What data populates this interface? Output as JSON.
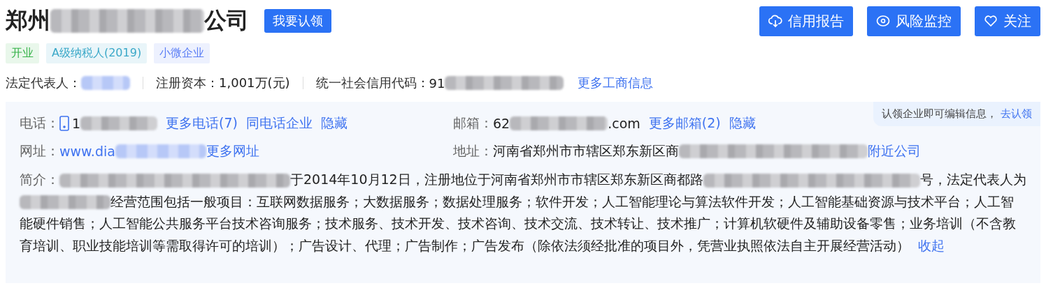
{
  "company": {
    "name_parts": [
      {
        "kind": "text",
        "text": "郑州"
      },
      {
        "kind": "blur"
      },
      {
        "kind": "text",
        "text": "公司"
      }
    ],
    "claim_button": "我要认领"
  },
  "actions": [
    {
      "kind": "report",
      "label": "信用报告"
    },
    {
      "kind": "monitor",
      "label": "风险监控"
    },
    {
      "kind": "follow",
      "label": "关注"
    }
  ],
  "tags": [
    {
      "label": "开业",
      "color": "#37b34a"
    },
    {
      "label": "A级纳税人(2019)",
      "color": "#3aa8c8"
    },
    {
      "label": "小微企业",
      "color": "#5b7ef5"
    }
  ],
  "basic": {
    "legal_rep_label": "法定代表人：",
    "capital_label": "注册资本：",
    "capital_value": "1,001万(元)",
    "credit_code_label": "统一社会信用代码：",
    "credit_code_value": "91",
    "more_link": "更多工商信息"
  },
  "contact": {
    "phone_label": "电话：",
    "phone_value": "1",
    "phone_links": [
      "更多电话(7)",
      "同电话企业",
      "隐藏"
    ],
    "email_label": "邮箱：",
    "email_value_start": "62",
    "email_value_end": ".com",
    "email_links": [
      "更多邮箱(2)",
      "隐藏"
    ],
    "website_label": "网址：",
    "website_value": "www.dia",
    "website_more": "更多网址",
    "address_label": "地址：",
    "address_value": "河南省郑州市市辖区郑东新区商",
    "address_link": "附近公司",
    "claim_hint": "认领企业即可编辑信息，",
    "claim_link": "去认领"
  },
  "intro": {
    "label": "简介：",
    "parts": [
      {
        "kind": "blur"
      },
      {
        "kind": "text",
        "text": "于2014年10月12日，注册地位于河南省郑州市市辖区郑东新区商都路"
      },
      {
        "kind": "blur"
      },
      {
        "kind": "text",
        "text": "号，法定代表人为"
      },
      {
        "kind": "blur"
      },
      {
        "kind": "text",
        "text": "经营范围包括一般项目：互联网数据服务；大数据服务；数据处理服务；软件开发；人工智能理论与算法软件开发；人工智能基础资源与技术平台；人工智能硬件销售；人工智能公共服务平台技术咨询服务；技术服务、技术开发、技术咨询、技术交流、技术转让、技术推广；计算机软硬件及辅助设备零售；业务培训（不含教育培训、职业技能培训等需取得许可的培训）；广告设计、代理；广告制作；广告发布（除依法须经批准的项目外，凭营业执照依法自主开展经营活动）"
      }
    ],
    "collapse_link": "收起"
  }
}
